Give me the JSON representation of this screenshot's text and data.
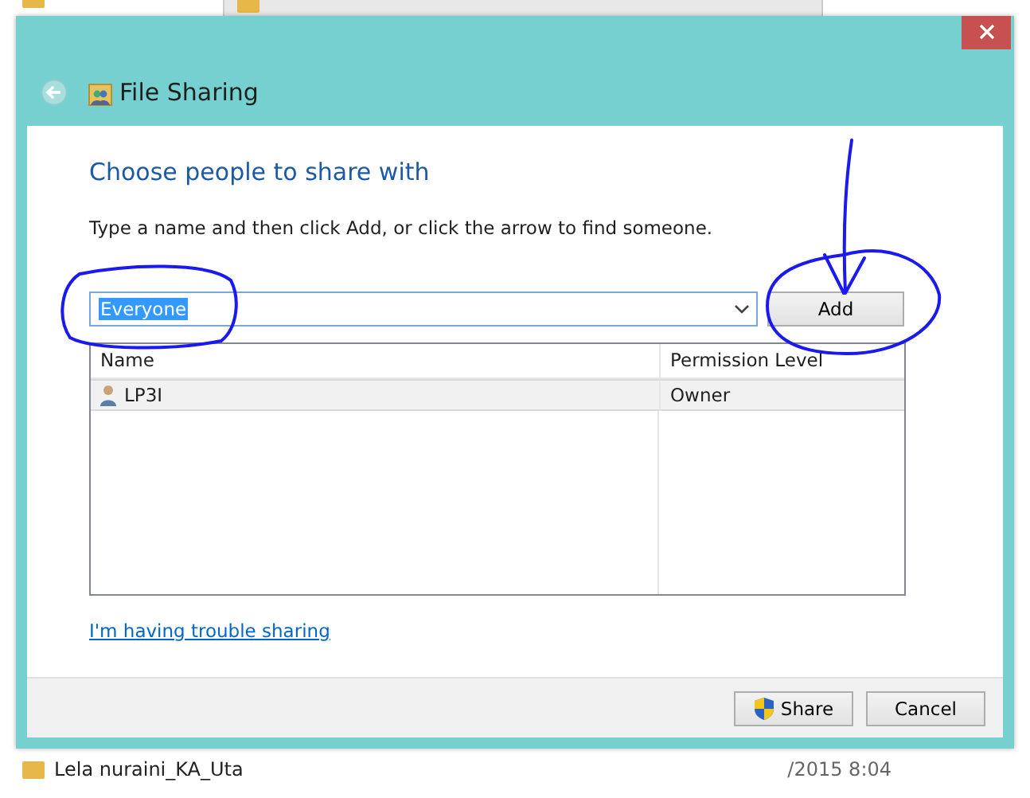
{
  "background": {
    "file_rows": [
      {
        "name": "Lela nuraini_KA_Uta",
        "date": "/2015 8:04"
      }
    ]
  },
  "dialog": {
    "title": "File Sharing",
    "heading": "Choose people to share with",
    "instruction": "Type a name and then click Add, or click the arrow to find someone.",
    "name_field": {
      "value": "Everyone",
      "text_selected": true
    },
    "add_button": "Add",
    "table": {
      "columns": [
        "Name",
        "Permission Level"
      ],
      "rows": [
        {
          "name": "LP3I",
          "permission": "Owner",
          "selected": true
        }
      ]
    },
    "help_link": "I'm having trouble sharing",
    "buttons": [
      {
        "label": "Share",
        "kind": "shield"
      },
      {
        "label": "Cancel",
        "kind": "plain"
      }
    ]
  }
}
